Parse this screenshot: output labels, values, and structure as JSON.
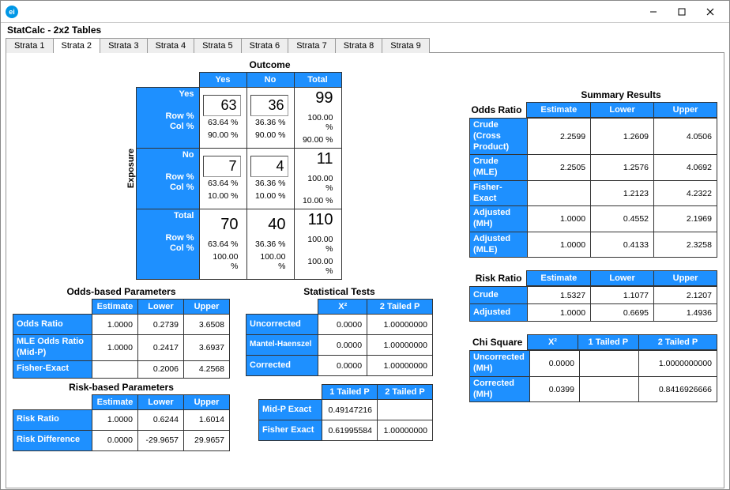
{
  "window": {
    "title": ""
  },
  "subtitle": "StatCalc - 2x2 Tables",
  "tabs": [
    "Strata 1",
    "Strata 2",
    "Strata 3",
    "Strata 4",
    "Strata 5",
    "Strata 6",
    "Strata 7",
    "Strata 8",
    "Strata 9"
  ],
  "active_tab_index": 1,
  "outcome_label": "Outcome",
  "exposure_label": "Exposure",
  "col_headers": [
    "Yes",
    "No",
    "Total"
  ],
  "row_defs": {
    "yes": {
      "label": "Yes",
      "rowpct_label": "Row %",
      "colpct_label": "Col %"
    },
    "no": {
      "label": "No",
      "rowpct_label": "Row %",
      "colpct_label": "Col %"
    },
    "total": {
      "label": "Total",
      "rowpct_label": "Row %",
      "colpct_label": "Col %"
    }
  },
  "table": {
    "yes": {
      "yes": "63",
      "no": "36",
      "total": "99",
      "rowpct": [
        "63.64 %",
        "36.36 %",
        "100.00 %"
      ],
      "colpct": [
        "90.00 %",
        "90.00 %",
        "90.00 %"
      ]
    },
    "no": {
      "yes": "7",
      "no": "4",
      "total": "11",
      "rowpct": [
        "63.64 %",
        "36.36 %",
        "100.00 %"
      ],
      "colpct": [
        "10.00 %",
        "10.00 %",
        "10.00 %"
      ]
    },
    "total": {
      "yes": "70",
      "no": "40",
      "total": "110",
      "rowpct": [
        "63.64 %",
        "36.36 %",
        "100.00 %"
      ],
      "colpct": [
        "100.00 %",
        "100.00 %",
        "100.00 %"
      ]
    }
  },
  "odds_params": {
    "title": "Odds-based Parameters",
    "headers": [
      "Estimate",
      "Lower",
      "Upper"
    ],
    "rows": [
      {
        "label": "Odds Ratio",
        "est": "1.0000",
        "low": "0.2739",
        "up": "3.6508"
      },
      {
        "label": "MLE Odds Ratio (Mid-P)",
        "est": "1.0000",
        "low": "0.2417",
        "up": "3.6937"
      },
      {
        "label": "Fisher-Exact",
        "est": "",
        "low": "0.2006",
        "up": "4.2568"
      }
    ]
  },
  "risk_params": {
    "title": "Risk-based Parameters",
    "headers": [
      "Estimate",
      "Lower",
      "Upper"
    ],
    "rows": [
      {
        "label": "Risk Ratio",
        "est": "1.0000",
        "low": "0.6244",
        "up": "1.6014"
      },
      {
        "label": "Risk Difference",
        "est": "0.0000",
        "low": "-29.9657",
        "up": "29.9657"
      }
    ]
  },
  "stat_tests": {
    "title": "Statistical Tests",
    "headers": [
      "X²",
      "2 Tailed P"
    ],
    "rows": [
      {
        "label": "Uncorrected",
        "x2": "0.0000",
        "p": "1.00000000"
      },
      {
        "label": "Mantel-Haenszel",
        "x2": "0.0000",
        "p": "1.00000000"
      },
      {
        "label": "Corrected",
        "x2": "0.0000",
        "p": "1.00000000"
      }
    ]
  },
  "exact_tests": {
    "headers": [
      "1 Tailed P",
      "2 Tailed P"
    ],
    "rows": [
      {
        "label": "Mid-P Exact",
        "p1": "0.49147216",
        "p2": ""
      },
      {
        "label": "Fisher Exact",
        "p1": "0.61995584",
        "p2": "1.00000000"
      }
    ]
  },
  "summary": {
    "title": "Summary Results",
    "odds": {
      "label": "Odds Ratio",
      "headers": [
        "Estimate",
        "Lower",
        "Upper"
      ],
      "rows": [
        {
          "label": "Crude\n(Cross Product)",
          "est": "2.2599",
          "low": "1.2609",
          "up": "4.0506"
        },
        {
          "label": "Crude (MLE)",
          "est": "2.2505",
          "low": "1.2576",
          "up": "4.0692"
        },
        {
          "label": "Fisher-Exact",
          "est": "",
          "low": "1.2123",
          "up": "4.2322"
        },
        {
          "label": "Adjusted (MH)",
          "est": "1.0000",
          "low": "0.4552",
          "up": "2.1969"
        },
        {
          "label": "Adjusted (MLE)",
          "est": "1.0000",
          "low": "0.4133",
          "up": "2.3258"
        }
      ]
    },
    "risk": {
      "label": "Risk Ratio",
      "headers": [
        "Estimate",
        "Lower",
        "Upper"
      ],
      "rows": [
        {
          "label": "Crude",
          "est": "1.5327",
          "low": "1.1077",
          "up": "2.1207"
        },
        {
          "label": "Adjusted",
          "est": "1.0000",
          "low": "0.6695",
          "up": "1.4936"
        }
      ]
    },
    "chi": {
      "label": "Chi Square",
      "headers": [
        "X²",
        "1 Tailed P",
        "2 Tailed P"
      ],
      "rows": [
        {
          "label": "Uncorrected (MH)",
          "x2": "0.0000",
          "p1": "",
          "p2": "1.0000000000"
        },
        {
          "label": "Corrected (MH)",
          "x2": "0.0399",
          "p1": "",
          "p2": "0.8416926666"
        }
      ]
    }
  }
}
